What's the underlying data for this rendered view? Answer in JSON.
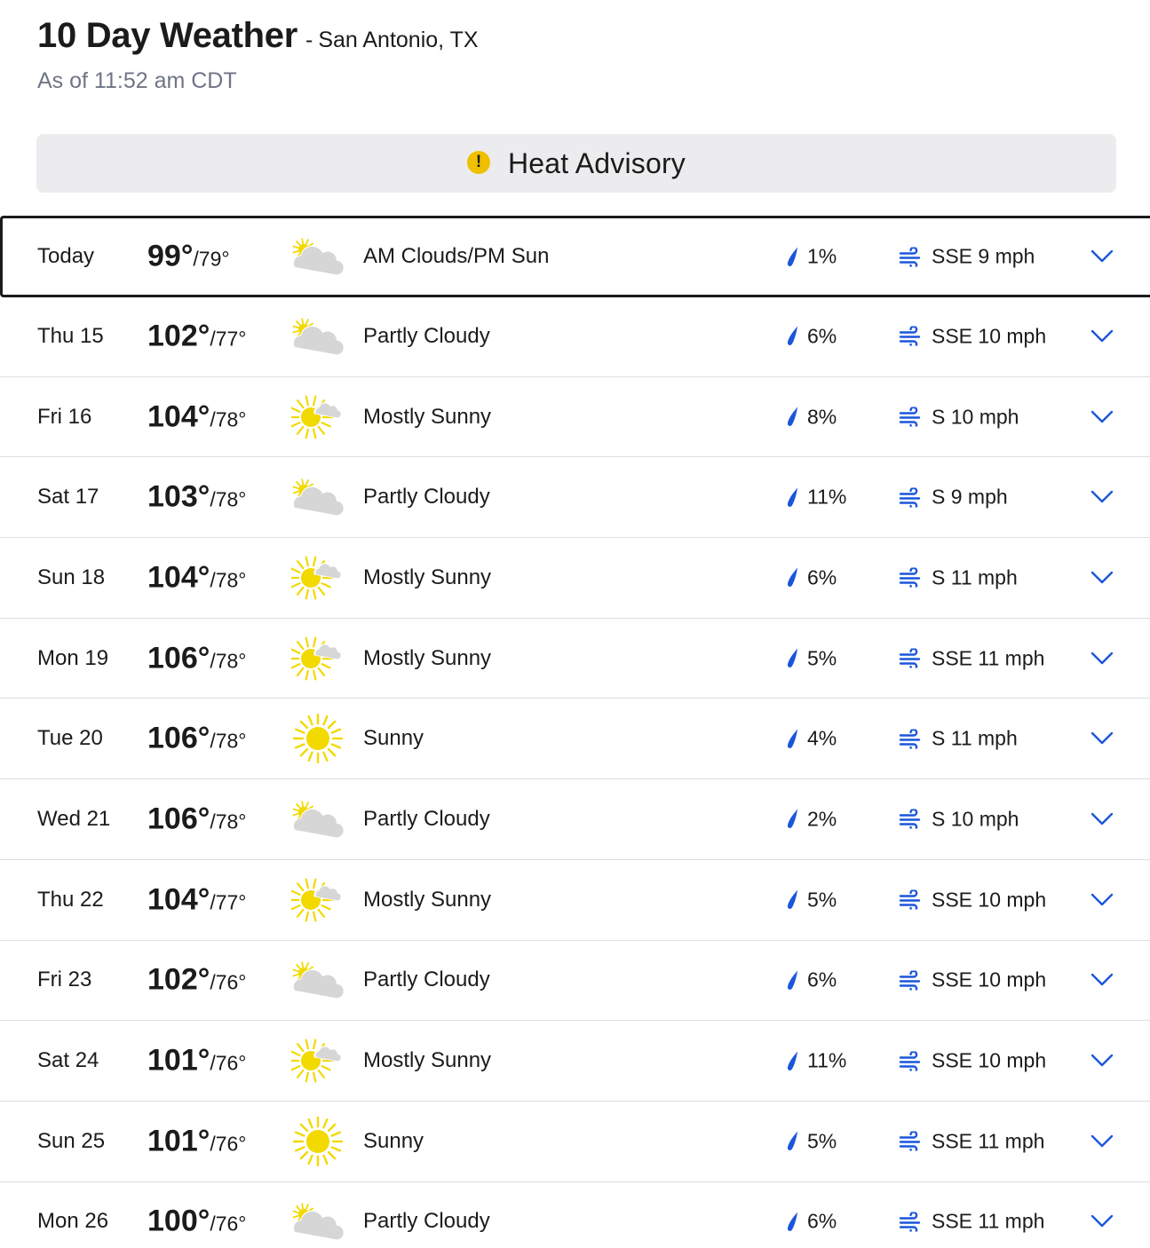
{
  "header": {
    "title": "10 Day Weather",
    "separator": "-",
    "location": "San Antonio, TX",
    "timestamp": "As of 11:52 am CDT"
  },
  "alert": {
    "label": "Heat Advisory",
    "icon_glyph": "!",
    "icon": "exclamation-circle-icon",
    "icon_color": "#f0c000"
  },
  "colors": {
    "accent": "#1a56db",
    "sun": "#f2d900",
    "cloud": "#d6d6d6"
  },
  "days": [
    {
      "day": "Today",
      "hi": "99°",
      "lo": "/79°",
      "icon": "partly-cloudy",
      "condition": "AM Clouds/PM Sun",
      "precip": "1%",
      "wind": "SSE 9 mph",
      "expanded": true
    },
    {
      "day": "Thu 15",
      "hi": "102°",
      "lo": "/77°",
      "icon": "partly-cloudy",
      "condition": "Partly Cloudy",
      "precip": "6%",
      "wind": "SSE 10 mph"
    },
    {
      "day": "Fri 16",
      "hi": "104°",
      "lo": "/78°",
      "icon": "mostly-sunny",
      "condition": "Mostly Sunny",
      "precip": "8%",
      "wind": "S 10 mph"
    },
    {
      "day": "Sat 17",
      "hi": "103°",
      "lo": "/78°",
      "icon": "partly-cloudy",
      "condition": "Partly Cloudy",
      "precip": "11%",
      "wind": "S 9 mph"
    },
    {
      "day": "Sun 18",
      "hi": "104°",
      "lo": "/78°",
      "icon": "mostly-sunny",
      "condition": "Mostly Sunny",
      "precip": "6%",
      "wind": "S 11 mph"
    },
    {
      "day": "Mon 19",
      "hi": "106°",
      "lo": "/78°",
      "icon": "mostly-sunny",
      "condition": "Mostly Sunny",
      "precip": "5%",
      "wind": "SSE 11 mph"
    },
    {
      "day": "Tue 20",
      "hi": "106°",
      "lo": "/78°",
      "icon": "sunny",
      "condition": "Sunny",
      "precip": "4%",
      "wind": "S 11 mph"
    },
    {
      "day": "Wed 21",
      "hi": "106°",
      "lo": "/78°",
      "icon": "partly-cloudy",
      "condition": "Partly Cloudy",
      "precip": "2%",
      "wind": "S 10 mph"
    },
    {
      "day": "Thu 22",
      "hi": "104°",
      "lo": "/77°",
      "icon": "mostly-sunny",
      "condition": "Mostly Sunny",
      "precip": "5%",
      "wind": "SSE 10 mph"
    },
    {
      "day": "Fri 23",
      "hi": "102°",
      "lo": "/76°",
      "icon": "partly-cloudy",
      "condition": "Partly Cloudy",
      "precip": "6%",
      "wind": "SSE 10 mph"
    },
    {
      "day": "Sat 24",
      "hi": "101°",
      "lo": "/76°",
      "icon": "mostly-sunny",
      "condition": "Mostly Sunny",
      "precip": "11%",
      "wind": "SSE 10 mph"
    },
    {
      "day": "Sun 25",
      "hi": "101°",
      "lo": "/76°",
      "icon": "sunny",
      "condition": "Sunny",
      "precip": "5%",
      "wind": "SSE 11 mph"
    },
    {
      "day": "Mon 26",
      "hi": "100°",
      "lo": "/76°",
      "icon": "partly-cloudy",
      "condition": "Partly Cloudy",
      "precip": "6%",
      "wind": "SSE 11 mph"
    }
  ]
}
